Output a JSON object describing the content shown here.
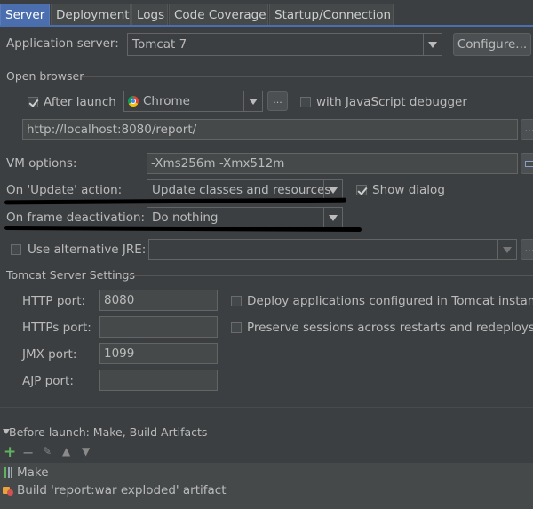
{
  "tabs": [
    {
      "label": "Server",
      "active": true
    },
    {
      "label": "Deployment"
    },
    {
      "label": "Logs"
    },
    {
      "label": "Code Coverage"
    },
    {
      "label": "Startup/Connection"
    }
  ],
  "app_server": {
    "label": "Application server:",
    "value": "Tomcat 7",
    "configure_label": "Configure..."
  },
  "open_browser": {
    "section_label": "Open browser",
    "after_launch_label": "After launch",
    "after_launch_checked": true,
    "browser": "Chrome",
    "more_label": "...",
    "js_debugger_label": "with JavaScript debugger",
    "url": "http://localhost:8080/report/"
  },
  "vm_options": {
    "label": "VM options:",
    "value": "-Xms256m -Xmx512m"
  },
  "update_action": {
    "label": "On 'Update' action:",
    "value": "Update classes and resources",
    "show_dialog_label": "Show dialog",
    "show_dialog_checked": true
  },
  "frame_deactivation": {
    "label": "On frame deactivation:",
    "value": "Do nothing"
  },
  "alt_jre": {
    "label": "Use alternative JRE:",
    "value": ""
  },
  "tomcat": {
    "section_label": "Tomcat Server Settings",
    "http_label": "HTTP port:",
    "http_value": "8080",
    "https_label": "HTTPs port:",
    "https_value": "",
    "jmx_label": "JMX port:",
    "jmx_value": "1099",
    "ajp_label": "AJP port:",
    "ajp_value": "",
    "deploy_label": "Deploy applications configured in Tomcat instance",
    "preserve_label": "Preserve sessions across restarts and redeploys"
  },
  "before_launch": {
    "label": "Before launch: Make, Build Artifacts",
    "items": [
      {
        "label": "Make",
        "icon": "make-icon"
      },
      {
        "label": "Build 'report:war exploded' artifact",
        "icon": "artifact-icon"
      }
    ]
  },
  "colors": {
    "accent": "#4b6eaf",
    "background": "#3c3f41",
    "add": "#5fb25f"
  }
}
